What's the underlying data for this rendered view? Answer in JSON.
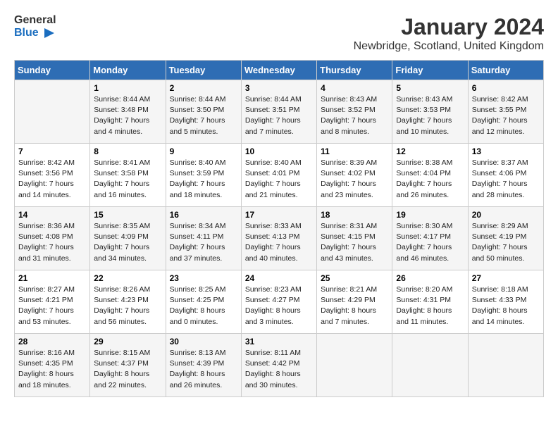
{
  "logo": {
    "text_general": "General",
    "text_blue": "Blue"
  },
  "title": "January 2024",
  "subtitle": "Newbridge, Scotland, United Kingdom",
  "days_header": [
    "Sunday",
    "Monday",
    "Tuesday",
    "Wednesday",
    "Thursday",
    "Friday",
    "Saturday"
  ],
  "weeks": [
    [
      {
        "day": "",
        "info": ""
      },
      {
        "day": "1",
        "info": "Sunrise: 8:44 AM\nSunset: 3:48 PM\nDaylight: 7 hours\nand 4 minutes."
      },
      {
        "day": "2",
        "info": "Sunrise: 8:44 AM\nSunset: 3:50 PM\nDaylight: 7 hours\nand 5 minutes."
      },
      {
        "day": "3",
        "info": "Sunrise: 8:44 AM\nSunset: 3:51 PM\nDaylight: 7 hours\nand 7 minutes."
      },
      {
        "day": "4",
        "info": "Sunrise: 8:43 AM\nSunset: 3:52 PM\nDaylight: 7 hours\nand 8 minutes."
      },
      {
        "day": "5",
        "info": "Sunrise: 8:43 AM\nSunset: 3:53 PM\nDaylight: 7 hours\nand 10 minutes."
      },
      {
        "day": "6",
        "info": "Sunrise: 8:42 AM\nSunset: 3:55 PM\nDaylight: 7 hours\nand 12 minutes."
      }
    ],
    [
      {
        "day": "7",
        "info": "Sunrise: 8:42 AM\nSunset: 3:56 PM\nDaylight: 7 hours\nand 14 minutes."
      },
      {
        "day": "8",
        "info": "Sunrise: 8:41 AM\nSunset: 3:58 PM\nDaylight: 7 hours\nand 16 minutes."
      },
      {
        "day": "9",
        "info": "Sunrise: 8:40 AM\nSunset: 3:59 PM\nDaylight: 7 hours\nand 18 minutes."
      },
      {
        "day": "10",
        "info": "Sunrise: 8:40 AM\nSunset: 4:01 PM\nDaylight: 7 hours\nand 21 minutes."
      },
      {
        "day": "11",
        "info": "Sunrise: 8:39 AM\nSunset: 4:02 PM\nDaylight: 7 hours\nand 23 minutes."
      },
      {
        "day": "12",
        "info": "Sunrise: 8:38 AM\nSunset: 4:04 PM\nDaylight: 7 hours\nand 26 minutes."
      },
      {
        "day": "13",
        "info": "Sunrise: 8:37 AM\nSunset: 4:06 PM\nDaylight: 7 hours\nand 28 minutes."
      }
    ],
    [
      {
        "day": "14",
        "info": "Sunrise: 8:36 AM\nSunset: 4:08 PM\nDaylight: 7 hours\nand 31 minutes."
      },
      {
        "day": "15",
        "info": "Sunrise: 8:35 AM\nSunset: 4:09 PM\nDaylight: 7 hours\nand 34 minutes."
      },
      {
        "day": "16",
        "info": "Sunrise: 8:34 AM\nSunset: 4:11 PM\nDaylight: 7 hours\nand 37 minutes."
      },
      {
        "day": "17",
        "info": "Sunrise: 8:33 AM\nSunset: 4:13 PM\nDaylight: 7 hours\nand 40 minutes."
      },
      {
        "day": "18",
        "info": "Sunrise: 8:31 AM\nSunset: 4:15 PM\nDaylight: 7 hours\nand 43 minutes."
      },
      {
        "day": "19",
        "info": "Sunrise: 8:30 AM\nSunset: 4:17 PM\nDaylight: 7 hours\nand 46 minutes."
      },
      {
        "day": "20",
        "info": "Sunrise: 8:29 AM\nSunset: 4:19 PM\nDaylight: 7 hours\nand 50 minutes."
      }
    ],
    [
      {
        "day": "21",
        "info": "Sunrise: 8:27 AM\nSunset: 4:21 PM\nDaylight: 7 hours\nand 53 minutes."
      },
      {
        "day": "22",
        "info": "Sunrise: 8:26 AM\nSunset: 4:23 PM\nDaylight: 7 hours\nand 56 minutes."
      },
      {
        "day": "23",
        "info": "Sunrise: 8:25 AM\nSunset: 4:25 PM\nDaylight: 8 hours\nand 0 minutes."
      },
      {
        "day": "24",
        "info": "Sunrise: 8:23 AM\nSunset: 4:27 PM\nDaylight: 8 hours\nand 3 minutes."
      },
      {
        "day": "25",
        "info": "Sunrise: 8:21 AM\nSunset: 4:29 PM\nDaylight: 8 hours\nand 7 minutes."
      },
      {
        "day": "26",
        "info": "Sunrise: 8:20 AM\nSunset: 4:31 PM\nDaylight: 8 hours\nand 11 minutes."
      },
      {
        "day": "27",
        "info": "Sunrise: 8:18 AM\nSunset: 4:33 PM\nDaylight: 8 hours\nand 14 minutes."
      }
    ],
    [
      {
        "day": "28",
        "info": "Sunrise: 8:16 AM\nSunset: 4:35 PM\nDaylight: 8 hours\nand 18 minutes."
      },
      {
        "day": "29",
        "info": "Sunrise: 8:15 AM\nSunset: 4:37 PM\nDaylight: 8 hours\nand 22 minutes."
      },
      {
        "day": "30",
        "info": "Sunrise: 8:13 AM\nSunset: 4:39 PM\nDaylight: 8 hours\nand 26 minutes."
      },
      {
        "day": "31",
        "info": "Sunrise: 8:11 AM\nSunset: 4:42 PM\nDaylight: 8 hours\nand 30 minutes."
      },
      {
        "day": "",
        "info": ""
      },
      {
        "day": "",
        "info": ""
      },
      {
        "day": "",
        "info": ""
      }
    ]
  ]
}
